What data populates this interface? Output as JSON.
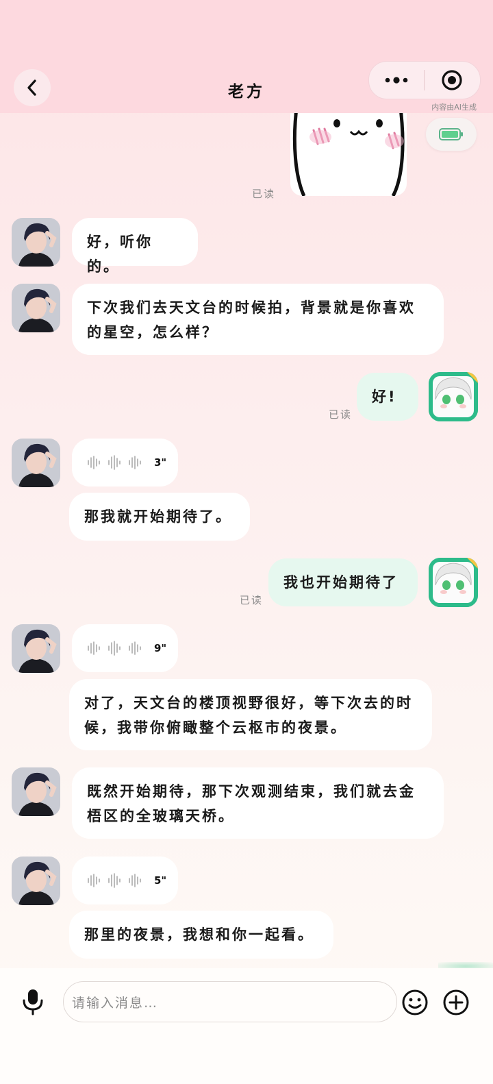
{
  "header": {
    "title": "老方",
    "ai_note": "内容由AI生成"
  },
  "messages": [
    {
      "type": "read_receipt",
      "text": "已读"
    },
    {
      "type": "text",
      "from": "other",
      "text": "好，听你的。"
    },
    {
      "type": "text",
      "from": "other",
      "text": "下次我们去天文台的时候拍，背景就是你喜欢的星空，怎么样？"
    },
    {
      "type": "text",
      "from": "me",
      "text": "好!",
      "read": "已读"
    },
    {
      "type": "voice",
      "from": "other",
      "duration": "3\""
    },
    {
      "type": "text",
      "from": "other",
      "text": "那我就开始期待了。"
    },
    {
      "type": "text",
      "from": "me",
      "text": "我也开始期待了",
      "read": "已读"
    },
    {
      "type": "voice",
      "from": "other",
      "duration": "9\""
    },
    {
      "type": "text",
      "from": "other",
      "text": "对了，天文台的楼顶视野很好，等下次去的时候，我带你俯瞰整个云枢市的夜景。"
    },
    {
      "type": "text",
      "from": "other",
      "text": "既然开始期待，那下次观测结束，我们就去金梧区的全玻璃天桥。"
    },
    {
      "type": "voice",
      "from": "other",
      "duration": "5\""
    },
    {
      "type": "text",
      "from": "other",
      "text": "那里的夜景，我想和你一起看。"
    }
  ],
  "input": {
    "placeholder": "请输入消息…"
  },
  "colors": {
    "header_bg": "#fdd9df",
    "my_bubble": "#e6f8ef",
    "other_bubble": "#ffffff",
    "accent_green": "#2dbb8a"
  },
  "icons": {
    "back": "chevron-left-icon",
    "more": "more-dots-icon",
    "close": "target-circle-icon",
    "mic": "microphone-icon",
    "emoji": "smiley-icon",
    "plus": "plus-circle-icon",
    "battery": "battery-icon",
    "voice": "sound-wave-icon"
  }
}
